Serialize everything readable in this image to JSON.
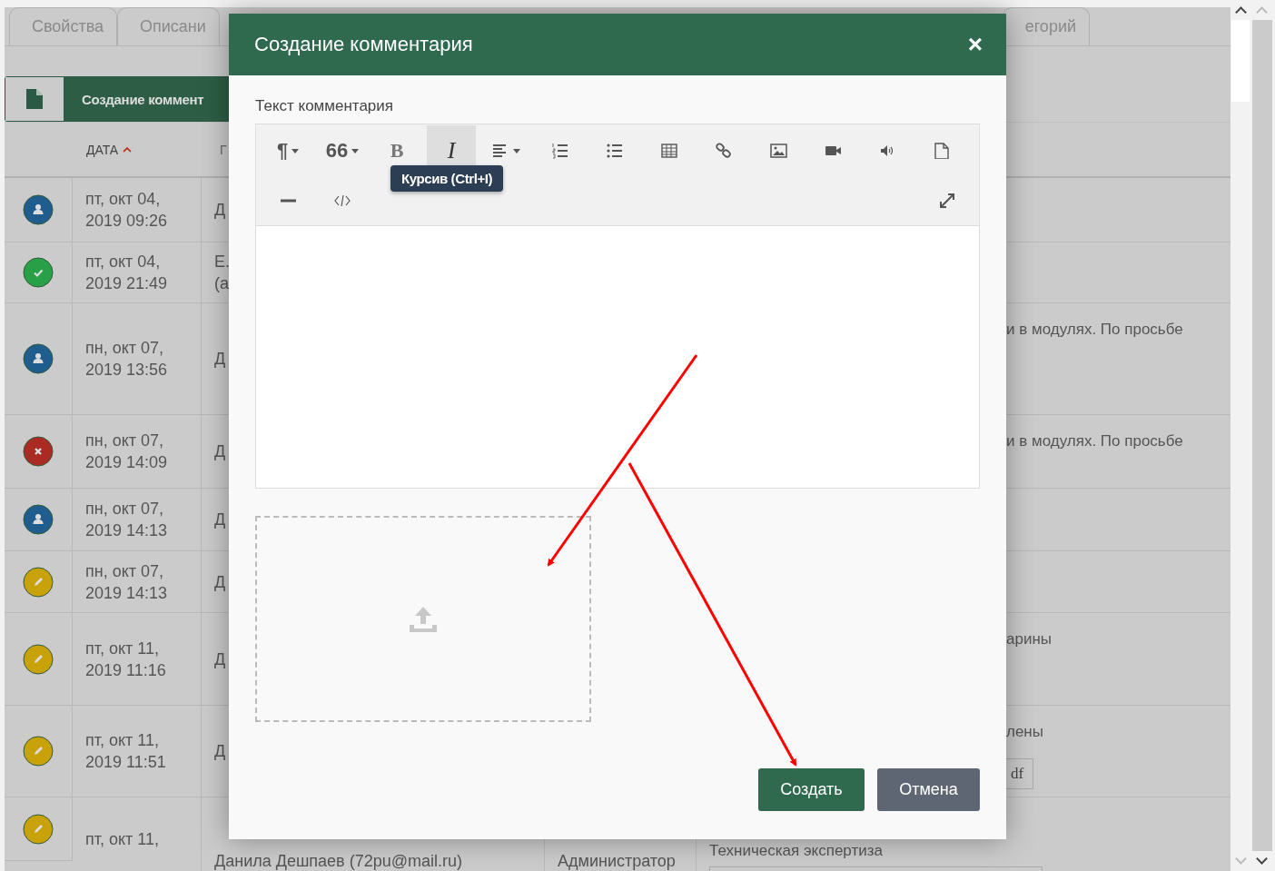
{
  "tabs": [
    {
      "label": "Свойства",
      "selected": false
    },
    {
      "label": "Описани",
      "selected": false
    },
    {
      "label": "егорий",
      "selected": false
    }
  ],
  "create_button": {
    "label": "Создание коммент"
  },
  "table": {
    "columns": [
      {
        "label": "ДАТА",
        "sorted": true
      },
      {
        "label": "Г"
      }
    ],
    "rows": [
      {
        "kind": "user",
        "date": "пт, окт 04, 2019 09:26",
        "column_3": "Д"
      },
      {
        "kind": "done",
        "date": "пт, окт 04, 2019 21:49",
        "column_3": "Е. (а"
      },
      {
        "kind": "user",
        "date": "пн, окт 07, 2019 13:56",
        "column_3": "Д",
        "column_5": "и в модулях. По просьбе"
      },
      {
        "kind": "rejected",
        "date": "пн, окт 07, 2019 14:09",
        "column_3": "Д",
        "column_5": "и в модулях. По просьбе"
      },
      {
        "kind": "user",
        "date": "пн, окт 07, 2019 14:13",
        "column_3": "Д"
      },
      {
        "kind": "edit",
        "date": "пн, окт 07, 2019 14:13",
        "column_3": "Д"
      },
      {
        "kind": "edit",
        "date": "пт, окт 11, 2019 11:16",
        "column_3": "Д",
        "column_5": "арины"
      },
      {
        "kind": "edit",
        "date": "пт, окт 11, 2019 11:51",
        "column_3": "Д",
        "column_5": "лены",
        "attachment": "df"
      },
      {
        "kind": "edit",
        "date": "пт, окт 11,",
        "column_3": "Данила Дешпаев (72pu@mail.ru)",
        "column_4": "Администратор",
        "column_5": "Техническая экспертиза"
      }
    ]
  },
  "dialog": {
    "title": "Создание комментария",
    "close": "×",
    "label": "Текст комментария",
    "toolbar": [
      {
        "kind": "paragraph",
        "glyph": "¶",
        "dropdown": true,
        "active": false
      },
      {
        "kind": "quote",
        "glyph": "66",
        "dropdown": true,
        "active": false
      },
      {
        "kind": "bold",
        "glyph": "B",
        "dropdown": false,
        "active": false
      },
      {
        "kind": "italic",
        "glyph": "I",
        "dropdown": false,
        "active": true,
        "tooltip": "Курсив (Ctrl+I)"
      },
      {
        "kind": "align",
        "dropdown": true,
        "active": false
      },
      {
        "kind": "ordered-list",
        "dropdown": false,
        "active": false
      },
      {
        "kind": "bullet-list",
        "dropdown": false,
        "active": false
      },
      {
        "kind": "table",
        "dropdown": false,
        "active": false
      },
      {
        "kind": "link",
        "dropdown": false,
        "active": false
      },
      {
        "kind": "image",
        "dropdown": false,
        "active": false
      },
      {
        "kind": "video",
        "dropdown": false,
        "active": false
      },
      {
        "kind": "audio",
        "dropdown": false,
        "active": false
      },
      {
        "kind": "file",
        "dropdown": false,
        "active": false
      },
      {
        "kind": "line",
        "dropdown": false,
        "active": false
      },
      {
        "kind": "code",
        "dropdown": false,
        "active": false
      }
    ],
    "buttons": [
      {
        "label": "Создать",
        "kind": "primary"
      },
      {
        "label": "Отмена",
        "kind": "secondary"
      }
    ]
  }
}
